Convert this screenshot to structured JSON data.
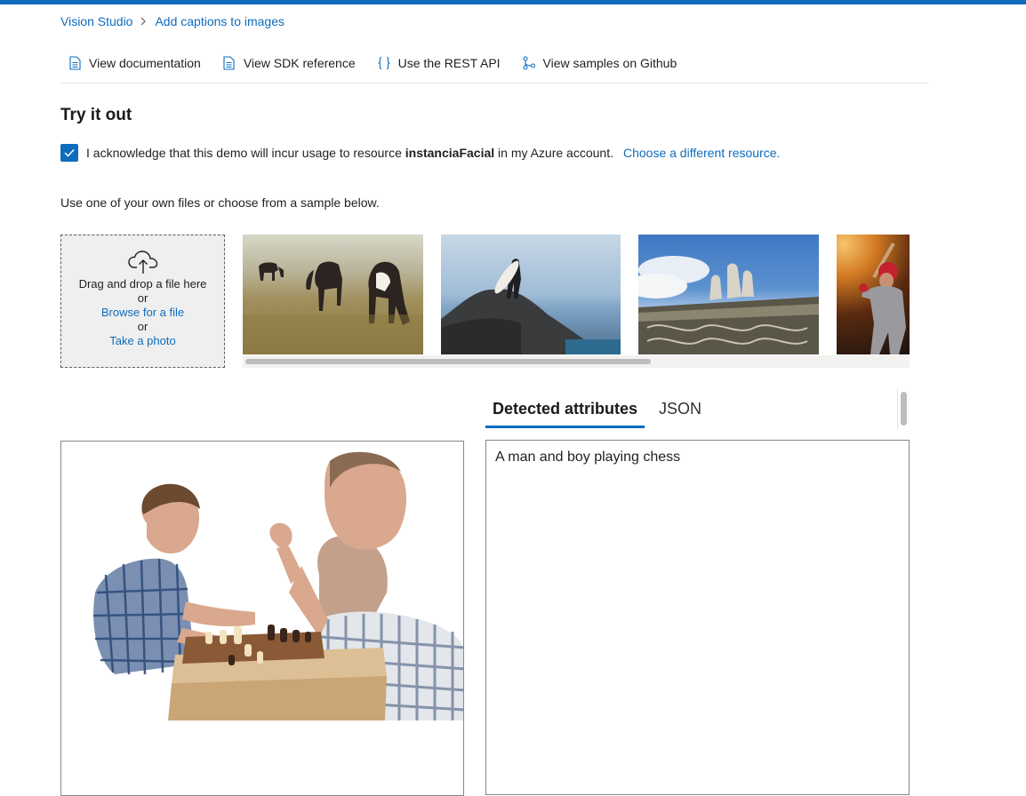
{
  "colors": {
    "accent": "#0f6cbd",
    "text": "#201f1e"
  },
  "breadcrumb": {
    "root": "Vision Studio",
    "current": "Add captions to images"
  },
  "links": [
    {
      "label": "View documentation",
      "icon": "document-icon"
    },
    {
      "label": "View SDK reference",
      "icon": "document-icon"
    },
    {
      "label": "Use the REST API",
      "icon": "braces-icon"
    },
    {
      "label": "View samples on Github",
      "icon": "branch-icon"
    }
  ],
  "try_it": {
    "title": "Try it out",
    "ack_prefix": "I acknowledge that this demo will incur usage to resource",
    "resource_name": "instanciaFacial",
    "ack_suffix": "in my Azure account.",
    "choose_link": "Choose a different resource.",
    "checked": true,
    "hint": "Use one of your own files or choose from a sample below."
  },
  "upload": {
    "drag_text": "Drag and drop a file here",
    "or_1": "or",
    "browse": "Browse for a file",
    "or_2": "or",
    "photo": "Take a photo"
  },
  "samples": [
    "cows-photo",
    "surfer-photo",
    "statues-photo",
    "baseball-photo"
  ],
  "tabs": [
    {
      "label": "Detected attributes",
      "active": true
    },
    {
      "label": "JSON",
      "active": false
    }
  ],
  "result": {
    "image": "man-and-boy-playing-chess-photo",
    "caption": "A man and boy playing chess"
  }
}
